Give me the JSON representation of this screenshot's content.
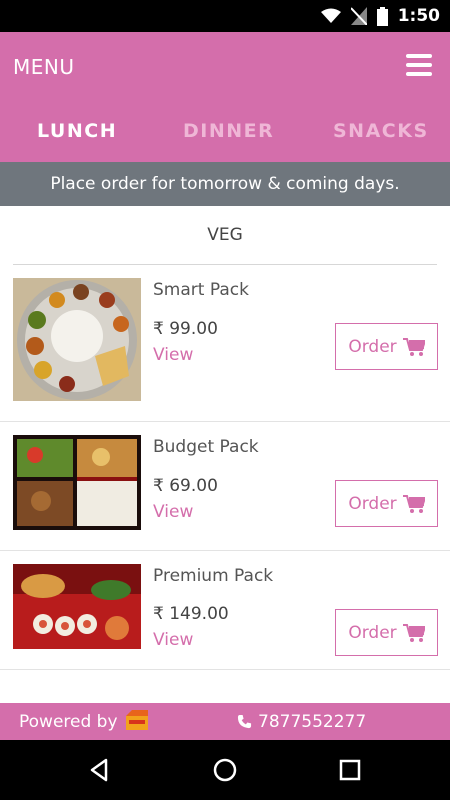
{
  "status_bar": {
    "time": "1:50",
    "icons": [
      "wifi-icon",
      "no-signal-icon",
      "battery-icon"
    ]
  },
  "header": {
    "title": "MENU",
    "menu_icon": "hamburger-icon"
  },
  "tabs": [
    {
      "label": "LUNCH",
      "active": true
    },
    {
      "label": "DINNER",
      "active": false
    },
    {
      "label": "SNACKS",
      "active": false
    }
  ],
  "notice": "Place order for tomorrow & coming days.",
  "category": "VEG",
  "items": [
    {
      "name": "Smart Pack",
      "price": "99.00",
      "currency": "₹",
      "view_label": "View",
      "order_label": "Order",
      "image": "thali-plate-image"
    },
    {
      "name": "Budget Pack",
      "price": "69.00",
      "currency": "₹",
      "view_label": "View",
      "order_label": "Order",
      "image": "bento-box-image"
    },
    {
      "name": "Premium Pack",
      "price": "149.00",
      "currency": "₹",
      "view_label": "View",
      "order_label": "Order",
      "image": "premium-platter-image"
    }
  ],
  "footer": {
    "powered_label": "Powered by",
    "phone": "7877552277"
  },
  "colors": {
    "accent": "#d46eab",
    "notice_bg": "#6f767d",
    "tab_inactive": "#efb6d6"
  }
}
